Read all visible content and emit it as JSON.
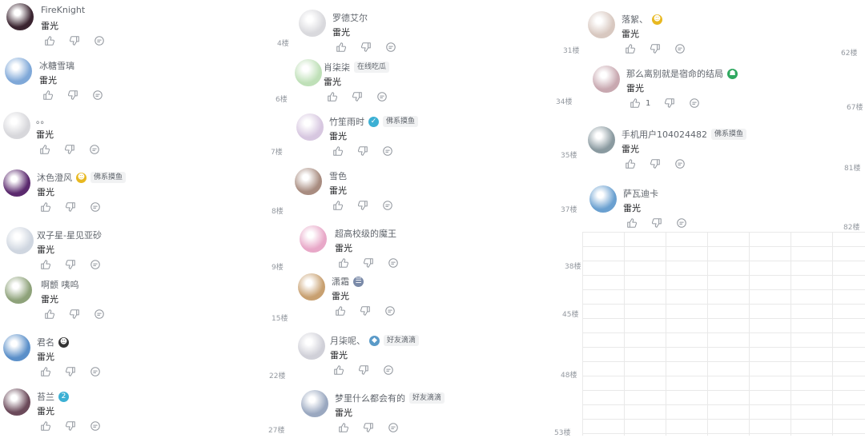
{
  "columns": [
    {
      "comments": [
        {
          "name": "FireKnight",
          "text": "雷光",
          "floor": "4楼",
          "av": "#3a2430"
        },
        {
          "name": "冰糖雪璃",
          "text": "雷光",
          "floor": "6楼",
          "av": "#7fa8d8"
        },
        {
          "name": "。。",
          "text": "雷光",
          "floor": "7楼",
          "av": "#d7d7db"
        },
        {
          "name": "沐色澄风",
          "text": "雷光",
          "floor": "8楼",
          "av": "#5b2a6e",
          "badge": "#e8b820",
          "badge_glyph": "☻",
          "tag": "佛系摸鱼"
        },
        {
          "name": "双子星-星见亚砂",
          "text": "雷光",
          "floor": "9楼",
          "av": "#cfd6e0"
        },
        {
          "name": "啊颤 咦呜",
          "text": "雷光",
          "floor": "15楼",
          "av": "#8ea27a"
        },
        {
          "name": "君名",
          "text": "雷光",
          "floor": "22楼",
          "av": "#5a8fc9",
          "badge": "#333333",
          "badge_glyph": "☻"
        },
        {
          "name": "苔兰",
          "text": "雷光",
          "floor": "27楼",
          "av": "#6b4a5a",
          "badge": "#3cb0d4",
          "badge_glyph": "2"
        }
      ]
    },
    {
      "comments": [
        {
          "name": "罗德艾尔",
          "text": "雷光",
          "floor": "31楼",
          "av": "#d9d9dd"
        },
        {
          "name": "肖柒柒",
          "text": "雷光",
          "floor": "34楼",
          "av": "#bfe0b8",
          "tag": "在线吃瓜"
        },
        {
          "name": "竹笙雨时",
          "text": "雷光",
          "floor": "35楼",
          "av": "#d7c7e0",
          "badge": "#3cb0d4",
          "badge_glyph": "✓",
          "tag": "佛系摸鱼"
        },
        {
          "name": "雪色",
          "text": "雷光",
          "floor": "37楼",
          "av": "#a88c80"
        },
        {
          "name": "超高校级的魔王",
          "text": "雷光",
          "floor": "38楼",
          "av": "#e8a8c8"
        },
        {
          "name": "潇霜",
          "text": "雷光",
          "floor": "45楼",
          "av": "#c8a070",
          "badge": "#7a8aa8",
          "badge_glyph": "☰"
        },
        {
          "name": "月柒呢、",
          "text": "雷光",
          "floor": "48楼",
          "av": "#d0d0d8",
          "badge": "#5a9ac8",
          "badge_glyph": "◆",
          "tag": "好友滴滴"
        },
        {
          "name": "梦里什么都会有的",
          "text": "雷光",
          "floor": "53楼",
          "av": "#9aa8c0",
          "tag": "好友滴滴"
        }
      ]
    },
    {
      "comments": [
        {
          "name": "落絮、",
          "text": "雷光",
          "floor": "62楼",
          "av": "#d8c8c0",
          "badge": "#e8b820",
          "badge_glyph": "☻"
        },
        {
          "name": "那么离别就是宿命的结局",
          "text": "雷光",
          "floor": "67楼",
          "av": "#c8a8b0",
          "badge": "#30a860",
          "badge_glyph": "☗",
          "likes": "1"
        },
        {
          "name": "手机用户104024482",
          "text": "雷光",
          "floor": "81楼",
          "av": "#8a9aa0",
          "tag": "佛系摸鱼"
        },
        {
          "name": "萨瓦迪卡",
          "text": "雷光",
          "floor": "82楼",
          "av": "#6aa0d0"
        }
      ]
    }
  ]
}
